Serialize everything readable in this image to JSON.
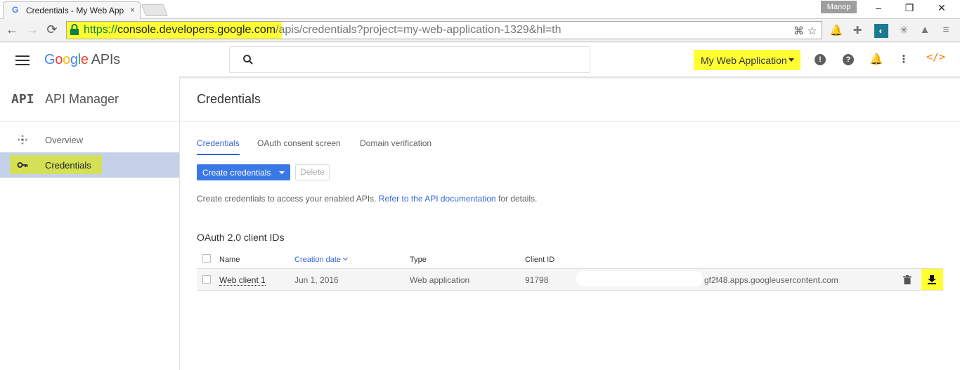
{
  "browser": {
    "tab_title": "Credentials - My Web App",
    "tab_close": "×",
    "profile_name": "Manop",
    "url_scheme": "https://",
    "url_host": "console.developers.google.com",
    "url_path": "/apis/credentials?project=my-web-application-1329&hl=th",
    "highlight_color": "#ffff33"
  },
  "header": {
    "logo_letters": [
      "G",
      "o",
      "o",
      "g",
      "l",
      "e"
    ],
    "logo_suffix": "APIs",
    "project_name": "My Web Application",
    "code_icon_glyph": "</>"
  },
  "sidebar": {
    "api_badge": "API",
    "title": "API Manager",
    "items": [
      {
        "label": "Overview",
        "icon": "move-icon",
        "active": false
      },
      {
        "label": "Credentials",
        "icon": "key-icon",
        "active": true
      }
    ]
  },
  "main": {
    "title": "Credentials",
    "tabs": [
      {
        "label": "Credentials",
        "selected": true
      },
      {
        "label": "OAuth consent screen",
        "selected": false
      },
      {
        "label": "Domain verification",
        "selected": false
      }
    ],
    "create_button": "Create credentials",
    "delete_button": "Delete",
    "description_prefix": "Create credentials to access your enabled APIs.",
    "description_link": "Refer to the API documentation",
    "description_suffix": "for details.",
    "section_title": "OAuth 2.0 client IDs",
    "columns": [
      "Name",
      "Creation date",
      "Type",
      "Client ID"
    ],
    "rows": [
      {
        "name": "Web client 1",
        "creation_date": "Jun 1, 2016",
        "type": "Web application",
        "client_id_prefix": "91798",
        "client_id_suffix": "gf2f48.apps.googleusercontent.com"
      }
    ]
  },
  "colors": {
    "accent": "#3b78e7",
    "link": "#3367d6",
    "sidebar_active": "#c5d1e8",
    "sidebar_highlight": "#d4e157"
  }
}
